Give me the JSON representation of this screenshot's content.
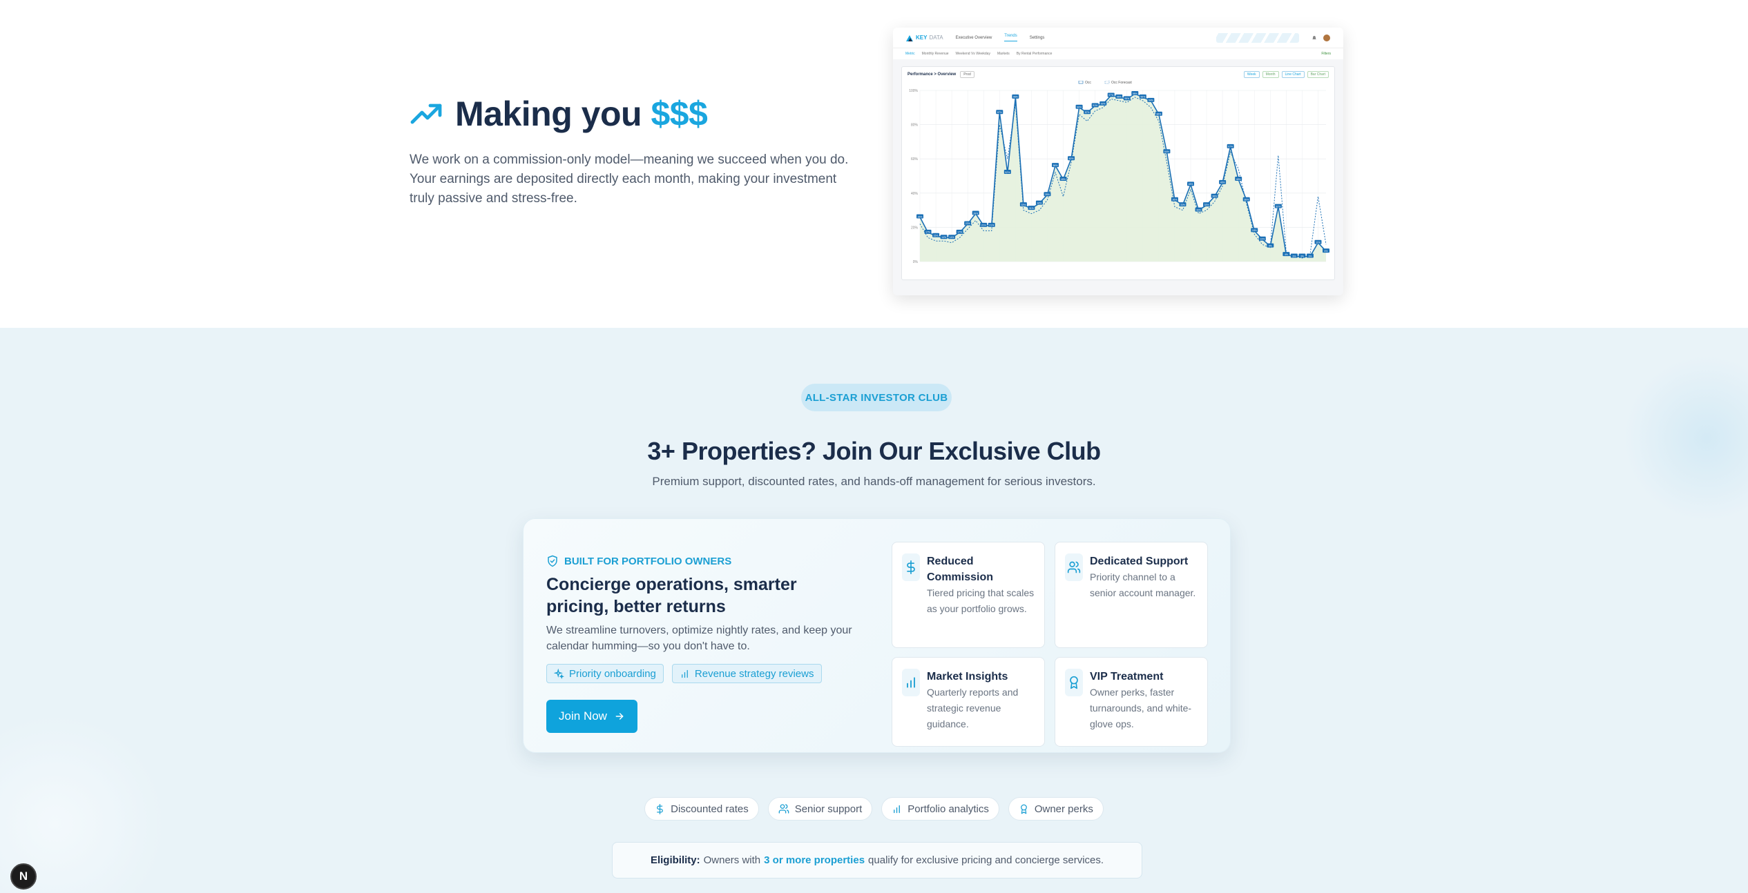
{
  "hero": {
    "title_main": "Making you",
    "title_accent": "$$$",
    "description": "We work on a commission-only model—meaning we succeed when you do. Your earnings are deposited directly each month, making your investment truly passive and stress-free."
  },
  "dashboard": {
    "logo_prefix": "KEY",
    "logo_suffix": "DATA",
    "nav_tabs": [
      "Executive Overview",
      "Trends",
      "Settings"
    ],
    "active_tab": "Trends",
    "sub_tabs": [
      "Metric",
      "Monthly Revenue",
      "Weekend Vs Weekday",
      "Markets",
      "By Rental Performance"
    ],
    "sub_right": "Filters",
    "breadcrumb": "Performance > Overview",
    "filter_chip": "Prod",
    "view_buttons": [
      "Week",
      "Month",
      "Line Chart",
      "Bar Chart"
    ],
    "legend": [
      "Occ",
      "Occ Forecast"
    ]
  },
  "chart_data": {
    "type": "line",
    "title": "",
    "ylabel": "",
    "xlabel": "",
    "ylim": [
      0,
      100
    ],
    "yticks": [
      "0%",
      "20%",
      "40%",
      "60%",
      "80%",
      "100%"
    ],
    "series": [
      {
        "name": "Occ",
        "values": [
          26,
          17,
          15,
          14,
          14,
          17,
          22,
          28,
          21,
          21,
          87,
          52,
          96,
          33,
          31,
          34,
          39,
          56,
          48,
          60,
          90,
          87,
          91,
          92,
          97,
          96,
          95,
          98,
          96,
          94,
          86,
          64,
          36,
          33,
          45,
          30,
          33,
          38,
          46,
          67,
          48,
          36,
          18,
          13,
          9,
          32,
          4,
          3,
          3,
          3,
          11,
          6
        ]
      },
      {
        "name": "Occ Forecast",
        "values": [
          22,
          14,
          12,
          12,
          11,
          14,
          19,
          24,
          18,
          18,
          80,
          60,
          92,
          30,
          28,
          30,
          36,
          52,
          38,
          58,
          86,
          82,
          88,
          90,
          95,
          94,
          93,
          96,
          94,
          90,
          82,
          58,
          32,
          30,
          42,
          28,
          30,
          35,
          44,
          64,
          54,
          34,
          16,
          10,
          8,
          62,
          5,
          3,
          2,
          4,
          38,
          10
        ]
      }
    ]
  },
  "club": {
    "badge": "ALL-STAR INVESTOR CLUB",
    "title": "3+ Properties? Join Our Exclusive Club",
    "subtitle": "Premium support, discounted rates, and hands-off management for serious investors.",
    "card": {
      "kicker": "BUILT FOR PORTFOLIO OWNERS",
      "heading": "Concierge operations, smarter pricing, better returns",
      "text": "We streamline turnovers, optimize nightly rates, and keep your calendar humming—so you don't have to.",
      "chips": [
        "Priority onboarding",
        "Revenue strategy reviews"
      ],
      "cta": "Join Now"
    },
    "features": [
      {
        "title": "Reduced Commission",
        "text": "Tiered pricing that scales as your portfolio grows.",
        "icon": "dollar-icon"
      },
      {
        "title": "Dedicated Support",
        "text": "Priority channel to a senior account manager.",
        "icon": "users-icon"
      },
      {
        "title": "Market Insights",
        "text": "Quarterly reports and strategic revenue guidance.",
        "icon": "bar-chart-icon"
      },
      {
        "title": "VIP Treatment",
        "text": "Owner perks, faster turnarounds, and white-glove ops.",
        "icon": "award-icon"
      }
    ],
    "pills": [
      "Discounted rates",
      "Senior support",
      "Portfolio analytics",
      "Owner perks"
    ],
    "eligibility": {
      "label": "Eligibility:",
      "before": "Owners with",
      "highlight": "3 or more properties",
      "after": "qualify for exclusive pricing and concierge services."
    }
  },
  "dev_badge": "N",
  "colors": {
    "accent": "#1aa6df",
    "navy": "#1b2d4a",
    "section_bg": "#e9f3f8",
    "chart_line": "#1a6fb5",
    "chart_fill": "#e4f1dd"
  }
}
